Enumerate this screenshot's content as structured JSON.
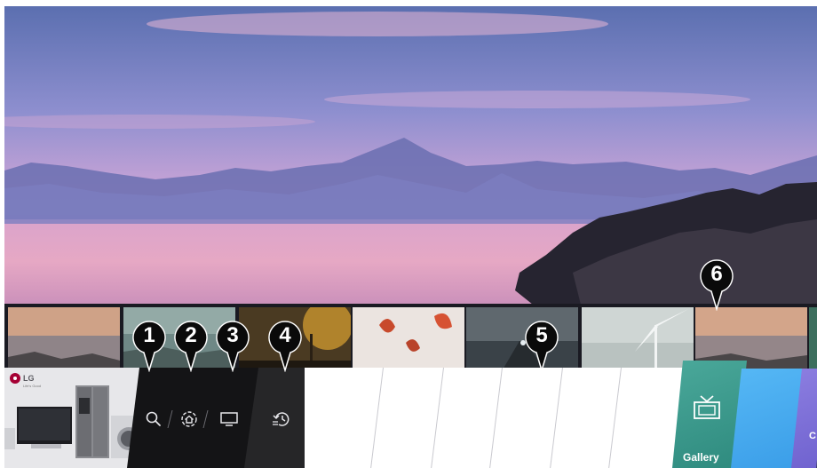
{
  "brand": {
    "logo_text": "LG",
    "logo_subtext": "Life's Good"
  },
  "navigation": {
    "search_icon": "search-icon",
    "home_icon": "home-dashboard-icon",
    "input_icon": "tv-input-icon",
    "recent_icon": "recent-history-icon"
  },
  "apps": {
    "gallery_label": "Gallery",
    "partial_label": "C"
  },
  "callouts": [
    "1",
    "2",
    "3",
    "4",
    "5",
    "6"
  ],
  "colors": {
    "nav_panel": "#141416",
    "gallery": "#3a9a8c",
    "blue_app": "#48abef",
    "purple_app": "#7c6fd8",
    "callout": "#0a0a0a"
  }
}
